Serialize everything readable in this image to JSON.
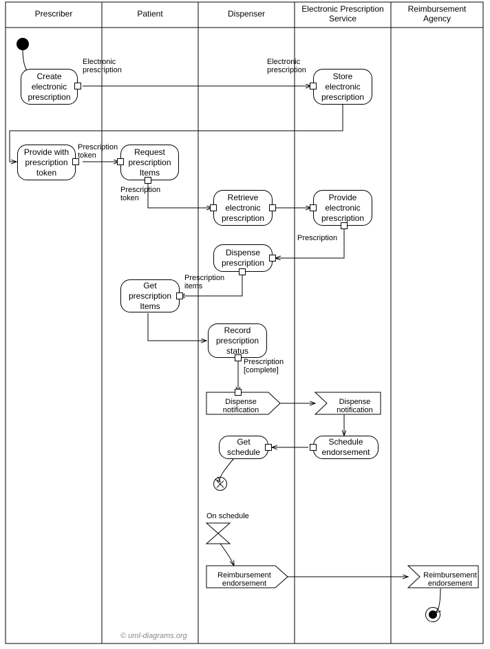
{
  "lanes": {
    "prescriber": "Prescriber",
    "patient": "Patient",
    "dispenser": "Dispenser",
    "eps": "Electronic Prescription Service",
    "reimbursement": "Reimbursement Agency"
  },
  "nodes": {
    "create_rx": "Create electronic prescription",
    "store_rx": "Store electronic prescription",
    "provide_token": "Provide with prescription token",
    "request_items": "Request prescription Items",
    "retrieve_rx": "Retrieve electronic prescription",
    "provide_rx": "Provide electronic prescription",
    "dispense_rx": "Dispense prescription",
    "get_items": "Get prescription Items",
    "record_status": "Record prescription status",
    "disp_notif_send": "Dispense notification",
    "disp_notif_recv": "Dispense notification",
    "schedule_endorse": "Schedule endorsement",
    "get_schedule": "Get schedule",
    "on_schedule": "On schedule",
    "reimb_send": "Reimbursement endorsement",
    "reimb_recv": "Reimbursement endorsement"
  },
  "edge_labels": {
    "electronic_rx_1": "Electronic prescription",
    "electronic_rx_2": "Electronic prescription",
    "rx_token_1": "Prescription token",
    "rx_token_2": "Prescription token",
    "prescription": "Prescription",
    "rx_items": "Prescription items",
    "rx_complete": "Prescription [complete]"
  },
  "copyright": "© uml-diagrams.org",
  "chart_data": {
    "type": "uml-activity",
    "swimlanes": [
      {
        "id": "prescriber",
        "label": "Prescriber",
        "x_range": [
          8,
          148
        ]
      },
      {
        "id": "patient",
        "label": "Patient",
        "x_range": [
          148,
          288
        ]
      },
      {
        "id": "dispenser",
        "label": "Dispenser",
        "x_range": [
          288,
          428
        ]
      },
      {
        "id": "eps",
        "label": "Electronic Prescription Service",
        "x_range": [
          428,
          568
        ]
      },
      {
        "id": "reimbursement",
        "label": "Reimbursement Agency",
        "x_range": [
          568,
          702
        ]
      }
    ],
    "nodes": [
      {
        "id": "initial",
        "type": "initial",
        "lane": "prescriber"
      },
      {
        "id": "create_rx",
        "type": "activity",
        "lane": "prescriber",
        "label": "Create electronic prescription"
      },
      {
        "id": "store_rx",
        "type": "activity",
        "lane": "eps",
        "label": "Store electronic prescription"
      },
      {
        "id": "provide_token",
        "type": "activity",
        "lane": "prescriber",
        "label": "Provide with prescription token"
      },
      {
        "id": "request_items",
        "type": "activity",
        "lane": "patient",
        "label": "Request prescription Items"
      },
      {
        "id": "retrieve_rx",
        "type": "activity",
        "lane": "dispenser",
        "label": "Retrieve electronic prescription"
      },
      {
        "id": "provide_rx",
        "type": "activity",
        "lane": "eps",
        "label": "Provide electronic prescription"
      },
      {
        "id": "dispense_rx",
        "type": "activity",
        "lane": "dispenser",
        "label": "Dispense prescription"
      },
      {
        "id": "get_items",
        "type": "activity",
        "lane": "patient",
        "label": "Get prescription Items"
      },
      {
        "id": "record_status",
        "type": "activity",
        "lane": "dispenser",
        "label": "Record prescription status"
      },
      {
        "id": "disp_notif_send",
        "type": "send-signal",
        "lane": "dispenser",
        "label": "Dispense notification"
      },
      {
        "id": "disp_notif_recv",
        "type": "accept-event",
        "lane": "eps",
        "label": "Dispense notification"
      },
      {
        "id": "schedule_endorse",
        "type": "activity",
        "lane": "eps",
        "label": "Schedule endorsement"
      },
      {
        "id": "get_schedule",
        "type": "activity",
        "lane": "dispenser",
        "label": "Get schedule"
      },
      {
        "id": "flow_final",
        "type": "flow-final",
        "lane": "dispenser"
      },
      {
        "id": "on_schedule",
        "type": "accept-time-event",
        "lane": "dispenser",
        "label": "On schedule"
      },
      {
        "id": "reimb_send",
        "type": "send-signal",
        "lane": "dispenser",
        "label": "Reimbursement endorsement"
      },
      {
        "id": "reimb_recv",
        "type": "accept-event",
        "lane": "reimbursement",
        "label": "Reimbursement endorsement"
      },
      {
        "id": "final",
        "type": "activity-final",
        "lane": "reimbursement"
      }
    ],
    "edges": [
      {
        "from": "initial",
        "to": "create_rx"
      },
      {
        "from": "create_rx",
        "to": "store_rx",
        "label": "Electronic prescription",
        "object_flow": true
      },
      {
        "from": "store_rx",
        "to": "provide_token"
      },
      {
        "from": "provide_token",
        "to": "request_items",
        "label": "Prescription token",
        "object_flow": true
      },
      {
        "from": "request_items",
        "to": "retrieve_rx",
        "label": "Prescription token",
        "object_flow": true
      },
      {
        "from": "retrieve_rx",
        "to": "provide_rx",
        "object_flow": true
      },
      {
        "from": "provide_rx",
        "to": "dispense_rx",
        "label": "Prescription",
        "object_flow": true
      },
      {
        "from": "dispense_rx",
        "to": "get_items",
        "label": "Prescription items",
        "object_flow": true
      },
      {
        "from": "get_items",
        "to": "record_status"
      },
      {
        "from": "record_status",
        "to": "disp_notif_send",
        "label": "Prescription [complete]",
        "object_flow": true
      },
      {
        "from": "disp_notif_send",
        "to": "disp_notif_recv"
      },
      {
        "from": "disp_notif_recv",
        "to": "schedule_endorse"
      },
      {
        "from": "schedule_endorse",
        "to": "get_schedule",
        "object_flow": true
      },
      {
        "from": "get_schedule",
        "to": "flow_final"
      },
      {
        "from": "on_schedule",
        "to": "reimb_send"
      },
      {
        "from": "reimb_send",
        "to": "reimb_recv"
      },
      {
        "from": "reimb_recv",
        "to": "final"
      }
    ]
  }
}
